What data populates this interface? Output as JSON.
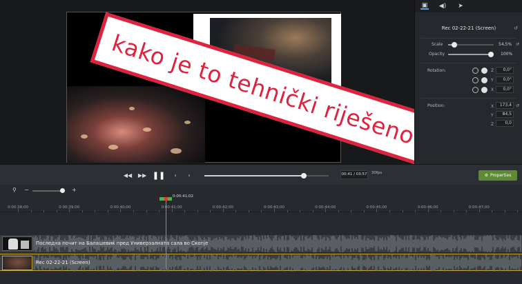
{
  "overlay": {
    "text": "kako je to tehnički riješeno?",
    "color": "#e0223f"
  },
  "properties_panel": {
    "tabs": [
      {
        "icon": "visual-properties-icon",
        "active": true
      },
      {
        "icon": "audio-properties-icon",
        "active": false
      },
      {
        "icon": "cursor-properties-icon",
        "active": false
      }
    ],
    "clip_name": "Rec 02-22-21 (Screen)",
    "scale": {
      "label": "Scale",
      "value": "54,5%",
      "level": 0.545
    },
    "opacity": {
      "label": "Opacity",
      "value": "100%",
      "level": 1.0
    },
    "rotation": {
      "label": "Rotation:",
      "z": "0,0°",
      "y": "0,0°",
      "x": "0,0°"
    },
    "position": {
      "label": "Position:",
      "x": "173,4",
      "y": "84,5",
      "z": "0,0"
    },
    "axis_labels": {
      "x": "X",
      "y": "Y",
      "z": "Z"
    }
  },
  "playback": {
    "timecode": "00:41 / 03:57",
    "fps": "30fps",
    "scrub_progress": 0.8,
    "properties_button": "Properties"
  },
  "timeline": {
    "zoom_minus": "−",
    "zoom_plus": "+",
    "playhead_time": "0:00:41;02",
    "ruler_labels": [
      "0:00:38;00",
      "0:00:39;00",
      "0:00:40;00",
      "0:00:41;00",
      "0:00:42;00",
      "0:00:43;00",
      "0:00:44;00",
      "0:00:45;00",
      "0:00:46;00",
      "0:00:47;00"
    ],
    "tracks": [
      {
        "label": "Последна почит на Балашевиќ пред Универзалната сала во Скопје",
        "selected": false
      },
      {
        "label": "Rec 02-22-21 (Screen)",
        "selected": true
      }
    ]
  },
  "colors": {
    "accent_green": "#5e8a32",
    "selection_gold": "#c9a92a"
  }
}
